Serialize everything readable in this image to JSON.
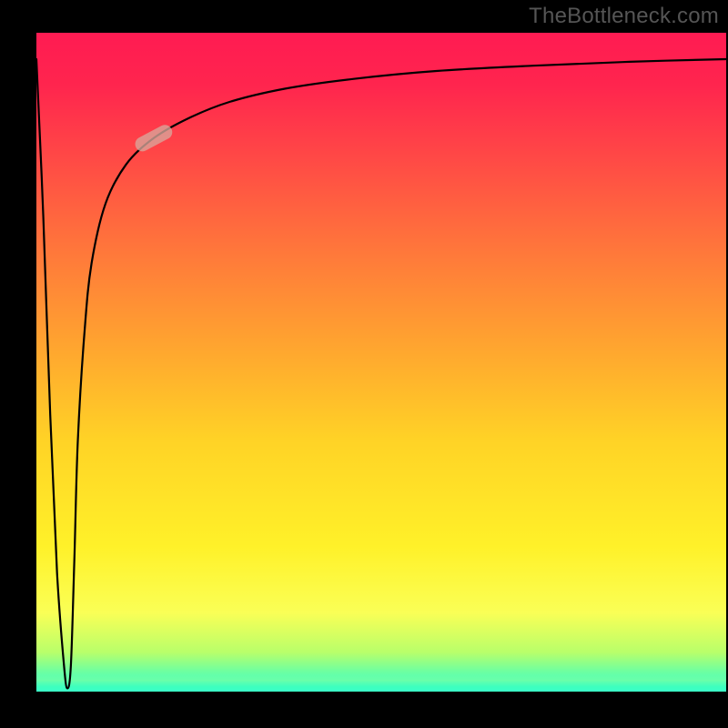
{
  "watermark": "TheBottleneck.com",
  "chart_data": {
    "type": "line",
    "title": "",
    "xlabel": "",
    "ylabel": "",
    "xlim": [
      0,
      100
    ],
    "ylim": [
      0,
      100
    ],
    "grid": false,
    "legend": false,
    "series": [
      {
        "name": "bottleneck-curve",
        "x": [
          0,
          1,
          2,
          3,
          4,
          4.5,
          5,
          5.5,
          6,
          7,
          8,
          10,
          13,
          17,
          22,
          28,
          36,
          46,
          58,
          72,
          86,
          100
        ],
        "y": [
          96,
          72,
          42,
          18,
          4,
          0.5,
          4,
          20,
          38,
          55,
          65,
          74,
          80,
          84,
          87,
          89.5,
          91.5,
          93,
          94.2,
          95,
          95.6,
          96
        ]
      }
    ],
    "marker": {
      "series": "bottleneck-curve",
      "x": 17,
      "y": 84,
      "angle_deg": -28
    },
    "background_gradient": {
      "orientation": "vertical",
      "stops": [
        {
          "pos": 0.0,
          "color": "#ff1b52"
        },
        {
          "pos": 0.34,
          "color": "#ff7a3a"
        },
        {
          "pos": 0.62,
          "color": "#ffd326"
        },
        {
          "pos": 0.88,
          "color": "#faff56"
        },
        {
          "pos": 1.0,
          "color": "#3dffd0"
        }
      ]
    }
  }
}
